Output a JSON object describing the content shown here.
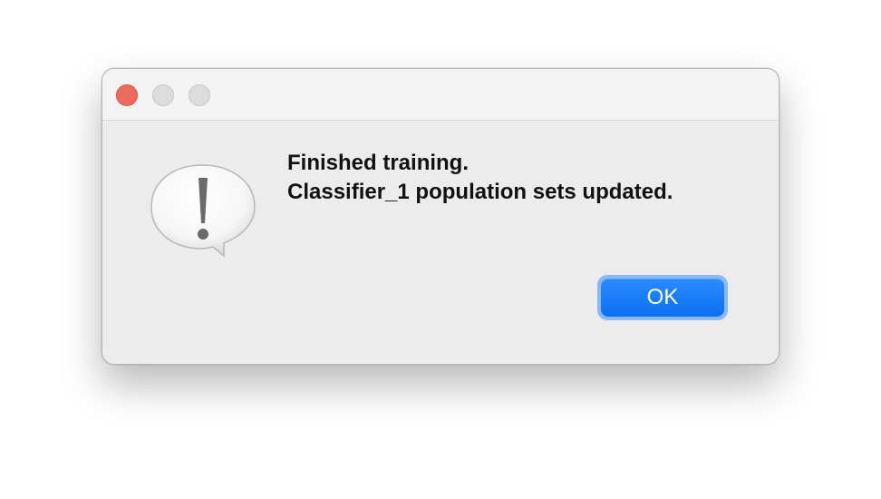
{
  "window": {
    "traffic_lights": {
      "close_color": "#ed6a5e",
      "inactive_color": "#dcdcdc"
    }
  },
  "alert": {
    "icon": "exclamation-speech-bubble-icon",
    "message_lines": [
      "Finished training.",
      "Classifier_1 population sets updated."
    ]
  },
  "buttons": {
    "ok_label": "OK",
    "ok_color": "#0b6ff2"
  }
}
